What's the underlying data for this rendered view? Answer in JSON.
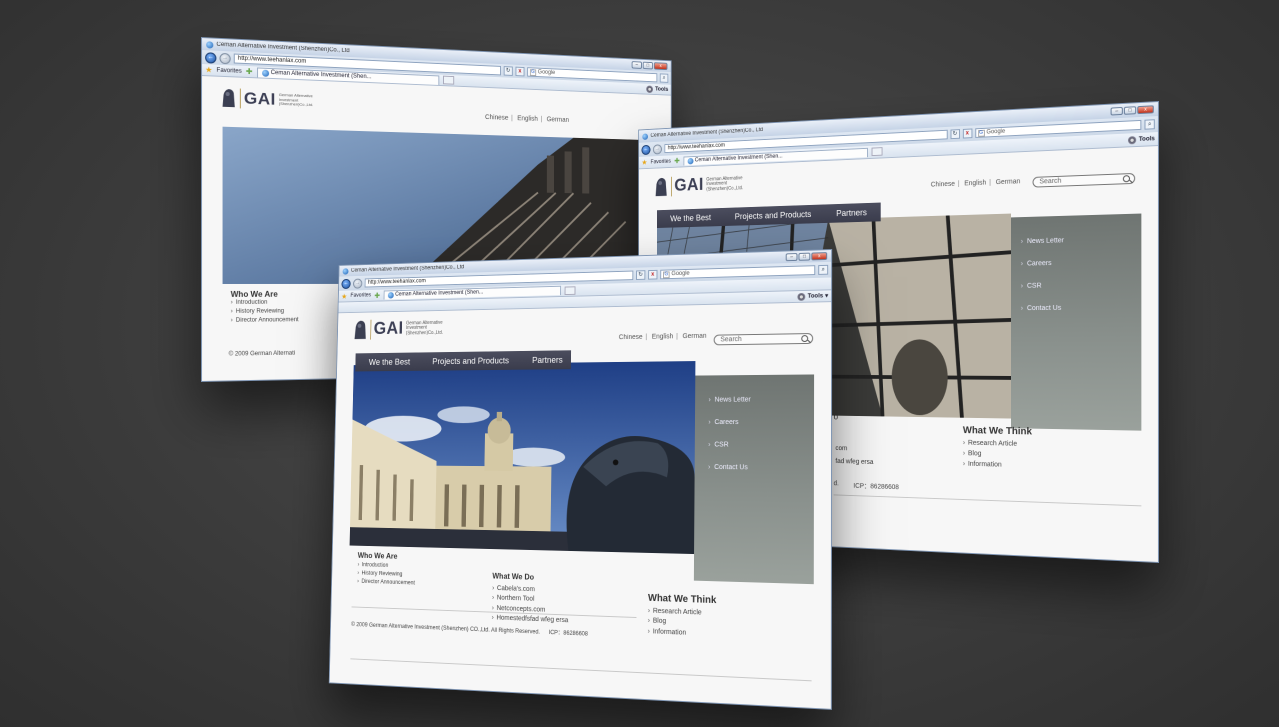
{
  "browser": {
    "title": "Ceman Alternative Investment (Shenzhen)Co., Ltd",
    "url": "http://www.teehanlax.com",
    "search_engine": "Google",
    "favorites": "Favorites",
    "tab_label": "Ceman Alternative Investment (Shen...",
    "tools": "Tools",
    "min": "–",
    "max": "□",
    "close": "x",
    "back": "←",
    "forward": "→",
    "refresh": "↻",
    "stop": "x",
    "go": "⌕",
    "dropdown": "▾",
    "search_engine_glyph": "G"
  },
  "site": {
    "logo": "GAI",
    "logo_sub_1": "German Alternative",
    "logo_sub_2": "Investment",
    "logo_sub_3": "(Shenzhen)Co.,Ltd.",
    "languages": [
      "Chinese",
      "English",
      "German"
    ],
    "search_placeholder": "Search",
    "nav": [
      "We the Best",
      "Projects and Products",
      "Partners"
    ],
    "side_menu": [
      "News Letter",
      "Careers",
      "CSR",
      "Contact Us"
    ],
    "who_we_are": {
      "heading": "Who We Are",
      "items": [
        "Introduction",
        "History Reviewing",
        "Director Announcement"
      ]
    },
    "what_we_do": {
      "heading": "What We Do",
      "items": [
        "Cabela's.com",
        "Northern Tool",
        "Netconcepts.com",
        "Homestedfsfad wfeg ersa"
      ]
    },
    "what_we_think": {
      "heading": "What We Think",
      "items": [
        "Research Article",
        "Blog",
        "Information"
      ]
    },
    "footer": "© 2009 German Alternative Investment (Shenzhen) CO.,Ltd. All Rights Reserved.",
    "icp": "ICP：86286608",
    "back_footer": "© 2009 German Alternati",
    "right_partial_heading": "o",
    "right_partial_items": [
      "com",
      "fad wfeg ersa"
    ],
    "right_partial_icp": "ICP：86286608",
    "right_partial_reserved": "d."
  },
  "colors": {
    "nav_bg": "#42444f",
    "side_panel": "#7d8480",
    "chrome_blue": "#c5d3e6",
    "logo_gold": "#b9a060"
  }
}
